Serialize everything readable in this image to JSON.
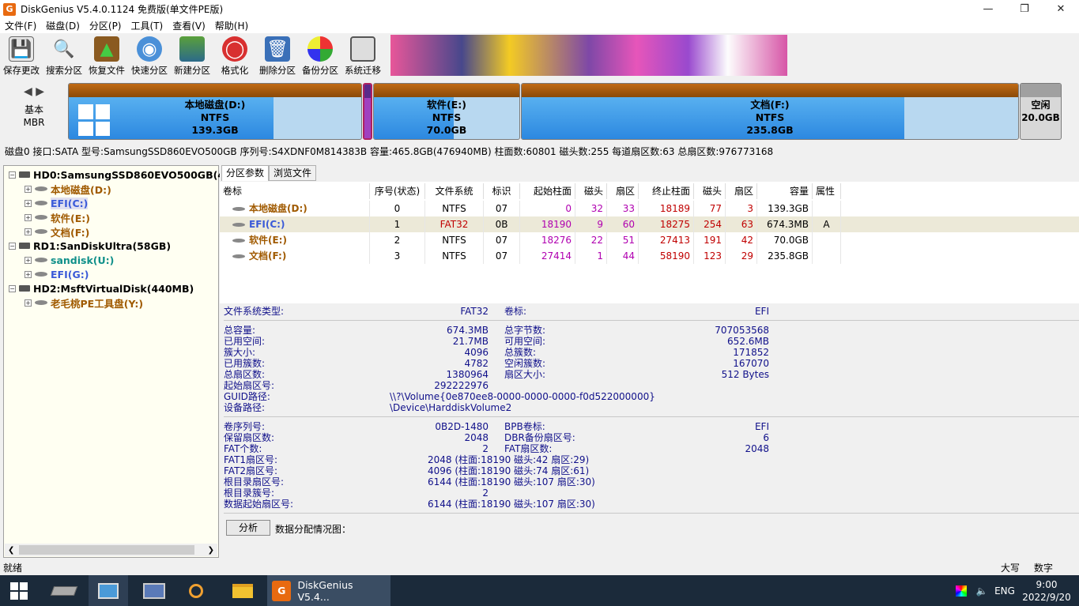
{
  "title": "DiskGenius V5.4.0.1124 免费版(单文件PE版)",
  "menu": [
    "文件(F)",
    "磁盘(D)",
    "分区(P)",
    "工具(T)",
    "查看(V)",
    "帮助(H)"
  ],
  "toolbar": [
    "保存更改",
    "搜索分区",
    "恢复文件",
    "快速分区",
    "新建分区",
    "格式化",
    "删除分区",
    "备份分区",
    "系统迁移"
  ],
  "diskmap": {
    "type": "基本",
    "scheme": "MBR",
    "partitions": [
      {
        "name": "本地磁盘(D:)",
        "fs": "NTFS",
        "size": "139.3GB"
      },
      {
        "name": "软件(E:)",
        "fs": "NTFS",
        "size": "70.0GB"
      },
      {
        "name": "文档(F:)",
        "fs": "NTFS",
        "size": "235.8GB"
      },
      {
        "name": "空闲",
        "fs": "",
        "size": "20.0GB"
      }
    ]
  },
  "diskinfo": "磁盘0 接口:SATA  型号:SamsungSSD860EVO500GB  序列号:S4XDNF0M814383B  容量:465.8GB(476940MB)  柱面数:60801  磁头数:255  每道扇区数:63  总扇区数:976773168",
  "tree": {
    "disks": [
      {
        "label": "HD0:SamsungSSD860EVO500GB(4",
        "children": [
          "本地磁盘(D:)",
          "EFI(C:)",
          "软件(E:)",
          "文档(F:)"
        ]
      },
      {
        "label": "RD1:SanDiskUltra(58GB)",
        "children": [
          "sandisk(U:)",
          "EFI(G:)"
        ]
      },
      {
        "label": "HD2:MsftVirtualDisk(440MB)",
        "children": [
          "老毛桃PE工具盘(Y:)"
        ]
      }
    ]
  },
  "tabs": [
    "分区参数",
    "浏览文件"
  ],
  "table": {
    "headers": [
      "卷标",
      "序号(状态)",
      "文件系统",
      "标识",
      "起始柱面",
      "磁头",
      "扇区",
      "终止柱面",
      "磁头",
      "扇区",
      "容量",
      "属性"
    ],
    "rows": [
      [
        "本地磁盘(D:)",
        "0",
        "NTFS",
        "07",
        "0",
        "32",
        "33",
        "18189",
        "77",
        "3",
        "139.3GB",
        ""
      ],
      [
        "EFI(C:)",
        "1",
        "FAT32",
        "0B",
        "18190",
        "9",
        "60",
        "18275",
        "254",
        "63",
        "674.3MB",
        "A"
      ],
      [
        "软件(E:)",
        "2",
        "NTFS",
        "07",
        "18276",
        "22",
        "51",
        "27413",
        "191",
        "42",
        "70.0GB",
        ""
      ],
      [
        "文档(F:)",
        "3",
        "NTFS",
        "07",
        "27414",
        "1",
        "44",
        "58190",
        "123",
        "29",
        "235.8GB",
        ""
      ]
    ]
  },
  "info": {
    "fs_type_label": "文件系统类型:",
    "fs_type": "FAT32",
    "vol_label_label": "卷标:",
    "vol_label": "EFI",
    "left1": [
      [
        "总容量:",
        "674.3MB"
      ],
      [
        "已用空间:",
        "21.7MB"
      ],
      [
        "簇大小:",
        "4096"
      ],
      [
        "已用簇数:",
        "4782"
      ],
      [
        "总扇区数:",
        "1380964"
      ],
      [
        "起始扇区号:",
        "292222976"
      ]
    ],
    "right1": [
      [
        "总字节数:",
        "707053568"
      ],
      [
        "可用空间:",
        "652.6MB"
      ],
      [
        "总簇数:",
        "171852"
      ],
      [
        "空闲簇数:",
        "167070"
      ],
      [
        "扇区大小:",
        "512 Bytes"
      ]
    ],
    "guid_label": "GUID路径:",
    "guid": "\\\\?\\Volume{0e870ee8-0000-0000-0000-f0d522000000}",
    "dev_label": "设备路径:",
    "dev": "\\Device\\HarddiskVolume2",
    "left2": [
      [
        "卷序列号:",
        "0B2D-1480"
      ],
      [
        "保留扇区数:",
        "2048"
      ],
      [
        "FAT个数:",
        "2"
      ],
      [
        "FAT1扇区号:",
        "2048 (柱面:18190 磁头:42 扇区:29)"
      ],
      [
        "FAT2扇区号:",
        "4096 (柱面:18190 磁头:74 扇区:61)"
      ],
      [
        "根目录扇区号:",
        "6144 (柱面:18190 磁头:107 扇区:30)"
      ],
      [
        "根目录簇号:",
        "2"
      ],
      [
        "数据起始扇区号:",
        "6144 (柱面:18190 磁头:107 扇区:30)"
      ]
    ],
    "right2": [
      [
        "BPB卷标:",
        "EFI"
      ],
      [
        "DBR备份扇区号:",
        "6"
      ],
      [
        "FAT扇区数:",
        "2048"
      ]
    ],
    "analyze": "分析",
    "alloc": "数据分配情况图："
  },
  "status": {
    "left": "就绪",
    "caps": "大写",
    "num": "数字"
  },
  "taskbar": {
    "app": "DiskGenius V5.4...",
    "lang": "ENG",
    "time": "9:00",
    "date": "2022/9/20"
  }
}
